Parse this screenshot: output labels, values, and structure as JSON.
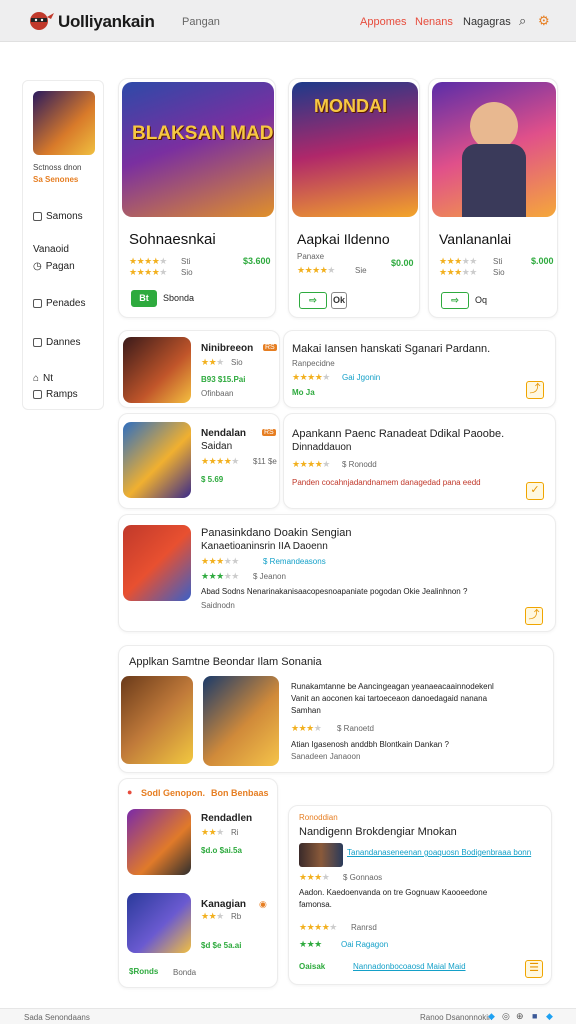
{
  "header": {
    "brand": "Uolliyankain",
    "sub": "Pangan",
    "nav": [
      "Appomes",
      "Nenans",
      "Nagagras"
    ],
    "accent": "#e74c3c"
  },
  "sidebar": {
    "thumb_caption1": "Sctnoss dnon",
    "thumb_caption2": "Sa Senones",
    "items": [
      "Samons",
      "Vanaoid",
      "Pagan",
      "Penades",
      "Dannes",
      "Nt",
      "Ramps"
    ]
  },
  "featured": [
    {
      "art": "BLAKSAN MADEEN",
      "title": "Sohnaesnkai",
      "rating_note": "Sti",
      "price": "$3.600",
      "note": "Sio",
      "button": "Bt",
      "button_label": "Sbonda",
      "stars": 4
    },
    {
      "art": "MONDAI",
      "title": "Aapkai Ildenno",
      "rating_note": "Panaxe",
      "price": "$0.00",
      "note": "Sie",
      "button": "Ok",
      "button_label": "Ok",
      "stars": 4
    },
    {
      "art": "",
      "title": "Vanlananlai",
      "rating_note": "Sti",
      "price": "$.000",
      "note": "Sio",
      "button": "Oo",
      "button_label": "Oq",
      "stars": 3
    }
  ],
  "list_left": [
    {
      "title": "Ninibreeon",
      "badge": "RS",
      "sub1": "Sio",
      "sub2": "B93 $15.Pai",
      "sub3": "Ofinbaan"
    },
    {
      "title": "Nendalan",
      "badge": "RS",
      "sub1": "Saidan",
      "sub2": "$11 $e",
      "sub3": "$ 5.69"
    }
  ],
  "list_right": [
    {
      "title": "Makai Iansen hanskati Sganari Pardann.",
      "sub": "Ranpecidne",
      "rating": "Gai Jgonin",
      "foot": "Mo Ja"
    },
    {
      "title": "Apankann Paenc Ranadeat Ddikal Paoobe.",
      "title2": "Dinnaddauon",
      "rating": "$ Ronodd",
      "body": "Panden cocahnjadandnamem danagedad pana eedd"
    }
  ],
  "wide_item": {
    "title1": "Panasinkdano Doakin Sengian",
    "title2": "Kanaetioaninsrin IIA Daoenn",
    "sub": "$ Remandeasons",
    "note": "$ Jeanon",
    "body": "Abad Sodns Nenarinakanisaacopesnoapaniate pogodan Okie Jealinhnon ?",
    "foot": "Saidnodn"
  },
  "section": {
    "heading": "Applkan Samtne Beondar Ilam Sonania",
    "body1": "Runakamtanne be Aancingeagan yeanaeacaainnodekenl",
    "body2": "Vanit an aoconen kai tartoeceaon danoedagaid nanana",
    "body3": "Samhan",
    "note": "$ Ranoetd",
    "body4": "Atian Igasenosh anddbh Blontkain Dankan ?",
    "foot": "Sanadeen Janaoon"
  },
  "bottom_left": {
    "header": "Sodl Genopon.",
    "header_right": "Bon Benbaas",
    "items": [
      {
        "title": "Rendadlen",
        "s1": "Ri",
        "s2": "$d.o $ai.5a"
      },
      {
        "title": "Kanagian",
        "s1": "Rb",
        "s2": "$d $e 5a.ai"
      }
    ],
    "foot": "$Ronds",
    "foot2": "Bonda"
  },
  "bottom_right": {
    "label": "Ronoddian",
    "title": "Nandigenn Brokdengiar Mnokan",
    "link": "Tanandanaseneenan goaquosn Bodigenbraaa bonn",
    "note": "$ Gonnaos",
    "body1": "Aadon. Kaedoenvanda on tre Gognuaw Kaooeedone",
    "body2": "famonsa.",
    "rating": "Ranrsd",
    "rating2": "Oai Ragagon",
    "foot": "Oaisak",
    "foot_link": "Nannadonbocoaosd Maial Maid"
  },
  "footer": {
    "left": "Sada Senondaans",
    "right": "Ranoo Dsanonnokin"
  }
}
